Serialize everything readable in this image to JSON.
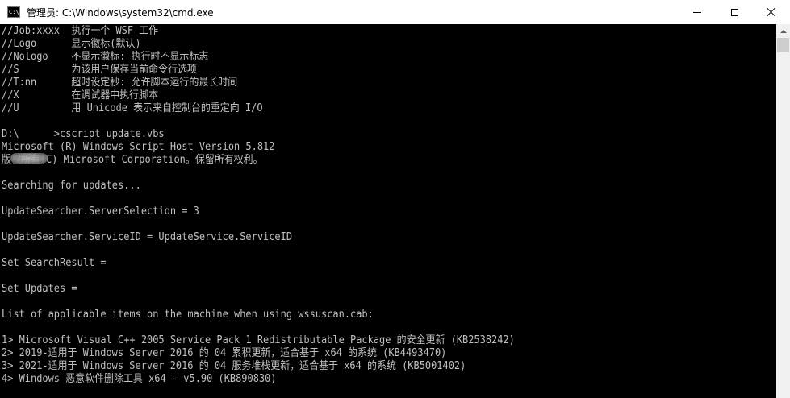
{
  "window": {
    "title": "管理员: C:\\Windows\\system32\\cmd.exe",
    "icon": "cmd-console-icon",
    "icon_text": "C:\\.",
    "controls": {
      "minimize_icon": "minimize-icon",
      "maximize_icon": "maximize-icon",
      "close_icon": "close-icon"
    }
  },
  "colors": {
    "console_background": "#000000",
    "console_text": "#c0c0c0",
    "titlebar": "#ffffff"
  },
  "console": {
    "lines": [
      "//Job:xxxx  执行一个 WSF 工作",
      "//Logo      显示徽标(默认)",
      "//Nologo    不显示徽标: 执行时不显示标志",
      "//S         为该用户保存当前命令行选项",
      "//T:nn      超时设定秒: 允许脚本运行的最长时间",
      "//X         在调试器中执行脚本",
      "//U         用 Unicode 表示来自控制台的重定向 I/O",
      "",
      "D:\\      >cscript update.vbs",
      "Microsoft (R) Windows Script Host Version 5.812",
      "版权所有(C) Microsoft Corporation。保留所有权利。",
      "",
      "Searching for updates...",
      "",
      "UpdateSearcher.ServerSelection = 3",
      "",
      "UpdateSearcher.ServiceID = UpdateService.ServiceID",
      "",
      "Set SearchResult =",
      "",
      "Set Updates =",
      "",
      "List of applicable items on the machine when using wssuscan.cab:",
      "",
      "1> Microsoft Visual C++ 2005 Service Pack 1 Redistributable Package 的安全更新 (KB2538242)",
      "2> 2019-适用于 Windows Server 2016 的 04 累积更新，适合基于 x64 的系统 (KB4493470)",
      "3> 2021-适用于 Windows Server 2016 的 04 服务堆栈更新，适合基于 x64 的系统 (KB5001402)",
      "4> Windows 恶意软件删除工具 x64 - v5.90 (KB890830)"
    ]
  }
}
